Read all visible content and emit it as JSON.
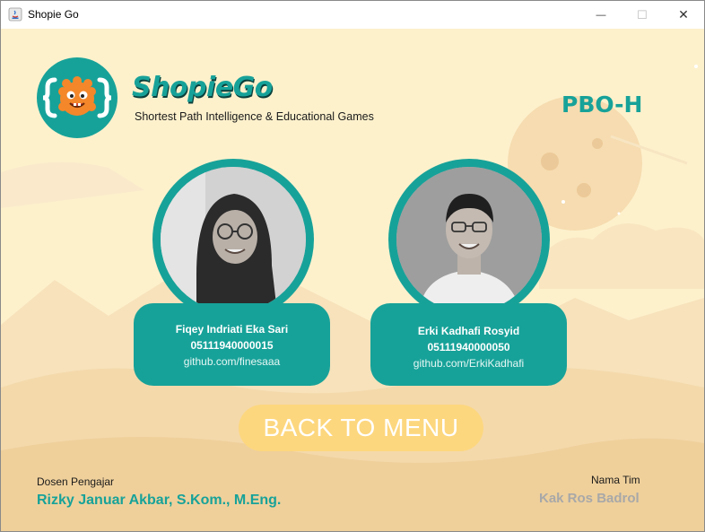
{
  "window": {
    "title": "Shopie Go",
    "minimize_glyph": "—",
    "maximize_glyph": "☐",
    "close_glyph": "✕",
    "icon": "java-app-icon"
  },
  "header": {
    "brand_name": "ShopieGo",
    "tagline": "Shortest Path Intelligence & Educational Games",
    "class_label": "PBO-H",
    "logo_icon": "monster-logo-icon"
  },
  "members": [
    {
      "name": "Fiqey Indriati Eka Sari",
      "nrp": "05111940000015",
      "github": "github.com/finesaaa"
    },
    {
      "name": "Erki Kadhafi Rosyid",
      "nrp": "05111940000050",
      "github": "github.com/ErkiKadhafi"
    }
  ],
  "back_button": {
    "label": "BACK TO MENU"
  },
  "footer": {
    "lecturer_label": "Dosen Pengajar",
    "lecturer_name": "Rizky Januar Akbar, S.Kom., M.Eng.",
    "team_label": "Nama Tim",
    "team_name": "Kak Ros Badrol"
  },
  "colors": {
    "primary": "#17a299",
    "background": "#fdf1cc",
    "button": "#fdd77e",
    "muted": "#a8a8a8"
  }
}
